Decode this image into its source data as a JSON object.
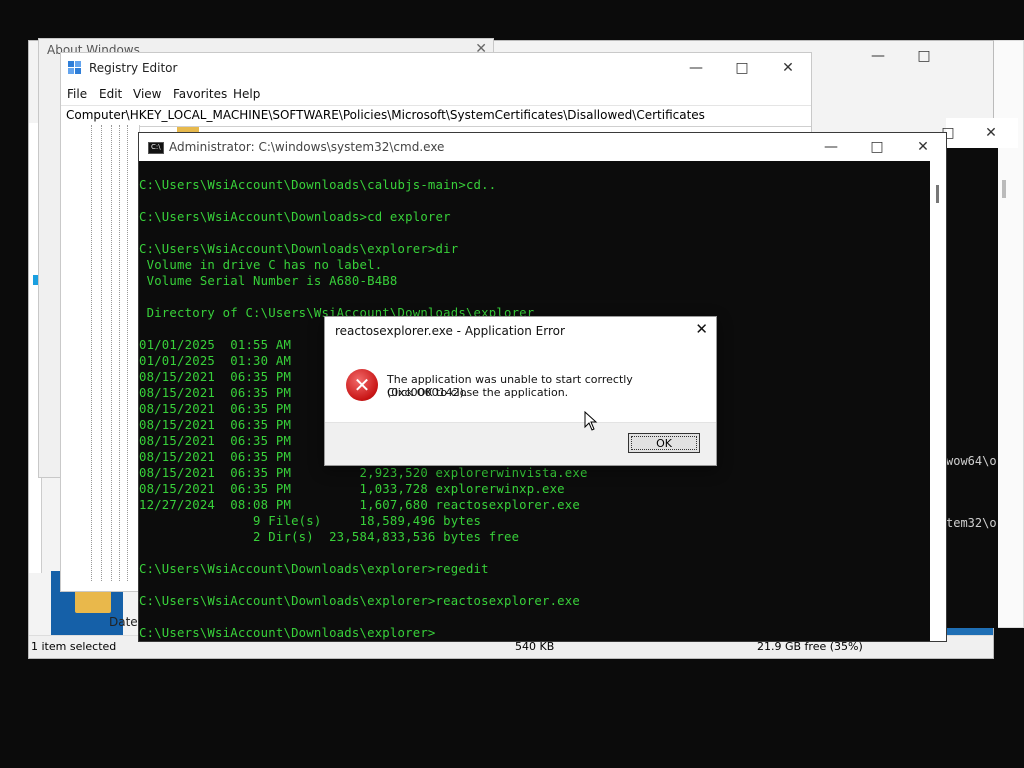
{
  "about_window": {
    "title": "About Windows"
  },
  "explorer": {
    "status_selected": "1 item selected",
    "status_size": "540 KB",
    "status_free": "21.9 GB free (35%)",
    "folder_column_label": "Date"
  },
  "right_console": {
    "line1": "wow64\\o",
    "line2": "tem32\\o"
  },
  "regedit": {
    "title": "Registry Editor",
    "menu": [
      "File",
      "Edit",
      "View",
      "Favorites",
      "Help"
    ],
    "address": "Computer\\HKEY_LOCAL_MACHINE\\SOFTWARE\\Policies\\Microsoft\\SystemCertificates\\Disallowed\\Certificates"
  },
  "cmd": {
    "title": "Administrator: C:\\windows\\system32\\cmd.exe",
    "lines": [
      "C:\\Users\\WsiAccount\\Downloads\\calubjs-main>cd..",
      "",
      "C:\\Users\\WsiAccount\\Downloads>cd explorer",
      "",
      "C:\\Users\\WsiAccount\\Downloads\\explorer>dir",
      " Volume in drive C has no label.",
      " Volume Serial Number is A680-B4B8",
      "",
      " Directory of C:\\Users\\WsiAccount\\Downloads\\explorer",
      "",
      "01/01/2025  01:55 AM",
      "01/01/2025  01:30 AM",
      "08/15/2021  06:35 PM",
      "08/15/2021  06:35 PM",
      "08/15/2021  06:35 PM",
      "08/15/2021  06:35 PM",
      "08/15/2021  06:35 PM",
      "08/15/2021  06:35 PM",
      "08/15/2021  06:35 PM         2,923,520 explorerwinvista.exe",
      "08/15/2021  06:35 PM         1,033,728 explorerwinxp.exe",
      "12/27/2024  08:08 PM         1,607,680 reactosexplorer.exe",
      "               9 File(s)     18,589,496 bytes",
      "               2 Dir(s)  23,584,833,536 bytes free",
      "",
      "C:\\Users\\WsiAccount\\Downloads\\explorer>regedit",
      "",
      "C:\\Users\\WsiAccount\\Downloads\\explorer>reactosexplorer.exe",
      "",
      "C:\\Users\\WsiAccount\\Downloads\\explorer>"
    ]
  },
  "dialog": {
    "title": "reactosexplorer.exe - Application Error",
    "message_line1": "The application was unable to start correctly (0xc0000142).",
    "message_line2": "Click OK to close the application.",
    "ok_label": "OK"
  },
  "icons": {
    "minimize": "minimize-icon",
    "maximize": "maximize-icon",
    "close": "close-icon",
    "error": "error-icon",
    "regedit_app": "registry-editor-icon",
    "cmd_app": "command-prompt-icon",
    "folder": "folder-icon"
  },
  "colors": {
    "console_text": "#38d13a",
    "console_bg": "#0c0c0c",
    "error_red": "#c81515"
  }
}
